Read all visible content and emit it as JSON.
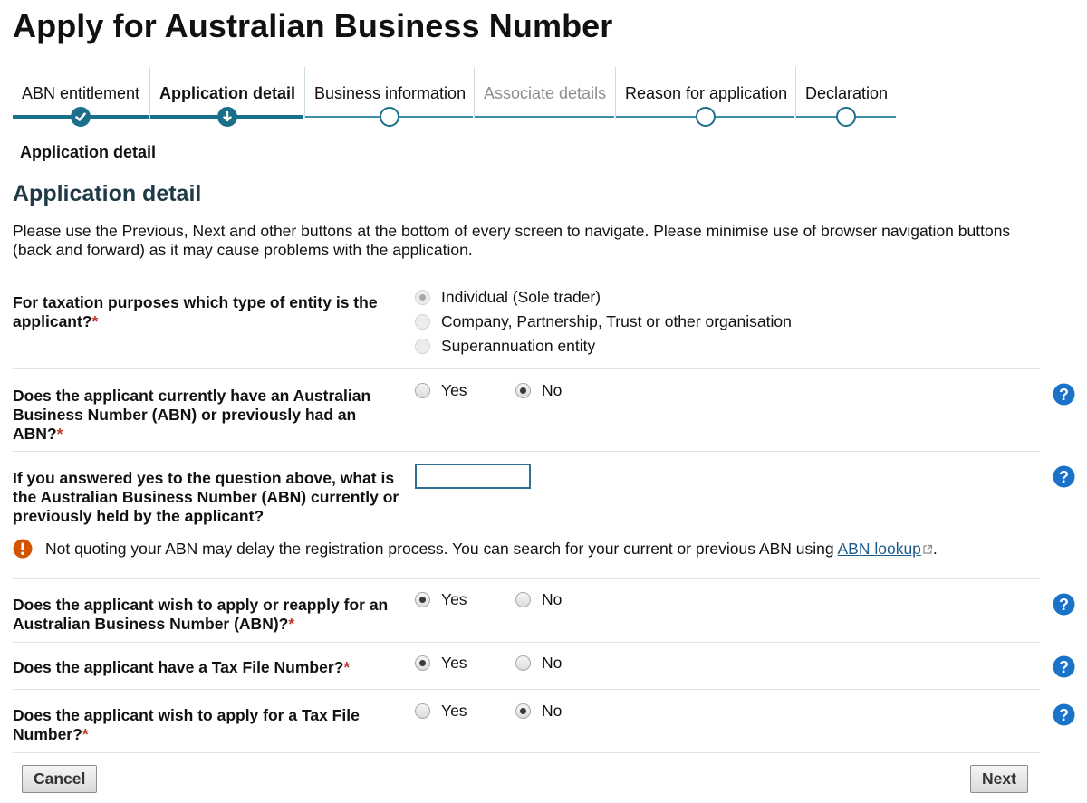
{
  "page": {
    "title": "Apply for Australian Business Number"
  },
  "steps": [
    {
      "label": "ABN entitlement",
      "state": "done"
    },
    {
      "label": "Application detail",
      "state": "current"
    },
    {
      "label": "Business information",
      "state": "pending"
    },
    {
      "label": "Associate details",
      "state": "disabled"
    },
    {
      "label": "Reason for application",
      "state": "pending"
    },
    {
      "label": "Declaration",
      "state": "pending"
    }
  ],
  "breadcrumb": "Application detail",
  "section": {
    "title": "Application detail",
    "intro": "Please use the Previous, Next and other buttons at the bottom of every screen to navigate. Please minimise use of browser navigation buttons (back and forward) as it may cause problems with the application."
  },
  "questions": {
    "entity_type": {
      "label": "For taxation purposes which type of entity is the applicant?",
      "required": "*",
      "options": [
        "Individual (Sole trader)",
        "Company, Partnership, Trust or other organisation",
        "Superannuation entity"
      ],
      "selected": "Individual (Sole trader)"
    },
    "has_abn": {
      "label": "Does the applicant currently have an Australian Business Number (ABN) or previously had an ABN?",
      "required": "*",
      "yes": "Yes",
      "no": "No",
      "selected": "No"
    },
    "abn_number": {
      "label": "If you answered yes to the question above, what is the Australian Business Number (ABN) currently or previously held by the applicant?",
      "value": "",
      "warning_text": "Not quoting your ABN may delay the registration process. You can search for your current or previous ABN using ",
      "link": "ABN lookup",
      "warning_end": "."
    },
    "apply_abn": {
      "label": "Does the applicant wish to apply or reapply for an Australian Business Number (ABN)?",
      "required": "*",
      "yes": "Yes",
      "no": "No",
      "selected": "Yes"
    },
    "has_tfn": {
      "label": "Does the applicant have a Tax File Number?",
      "required": "*",
      "yes": "Yes",
      "no": "No",
      "selected": "Yes"
    },
    "apply_tfn": {
      "label": "Does the applicant wish to apply for a Tax File Number?",
      "required": "*",
      "yes": "Yes",
      "no": "No",
      "selected": "No"
    }
  },
  "buttons": {
    "cancel": "Cancel",
    "next": "Next"
  },
  "colors": {
    "accent": "#1a6f8a",
    "help": "#1a73c9",
    "warning": "#d35400",
    "required": "#c0392b"
  },
  "icons": [
    "check-icon",
    "arrow-down-icon",
    "help-icon",
    "warning-icon",
    "external-link-icon"
  ]
}
